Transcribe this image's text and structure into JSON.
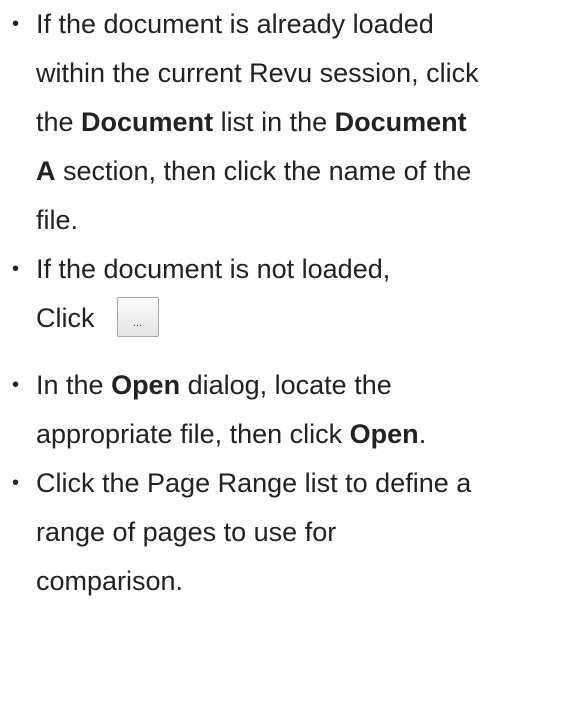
{
  "steps": [
    {
      "lines": [
        [
          {
            "t": "If the document is already loaded"
          }
        ],
        [
          {
            "t": "within the current Revu session, click"
          }
        ],
        [
          {
            "t": "the "
          },
          {
            "t": "Document",
            "b": true
          },
          {
            "t": " list in the "
          },
          {
            "t": "Document",
            "b": true
          }
        ],
        [
          {
            "t": "A",
            "b": true
          },
          {
            "t": " section, then click the name of the"
          }
        ],
        [
          {
            "t": "file."
          }
        ]
      ]
    },
    {
      "lines": [
        [
          {
            "t": "If the document is not loaded,"
          }
        ],
        [
          {
            "t": "Click"
          }
        ]
      ],
      "button": {
        "icon": "browse-ellipsis-icon",
        "label": "..."
      }
    },
    {
      "lines": [
        [
          {
            "t": "In the "
          },
          {
            "t": "Open",
            "b": true
          },
          {
            "t": " dialog, locate the"
          }
        ],
        [
          {
            "t": "appropriate file, then click "
          },
          {
            "t": "Open",
            "b": true
          },
          {
            "t": "."
          }
        ]
      ]
    },
    {
      "lines": [
        [
          {
            "t": "Click the Page Range list to define a"
          }
        ],
        [
          {
            "t": "range of pages to use for"
          }
        ],
        [
          {
            "t": "comparison."
          }
        ]
      ]
    }
  ],
  "bullet_char": "•"
}
